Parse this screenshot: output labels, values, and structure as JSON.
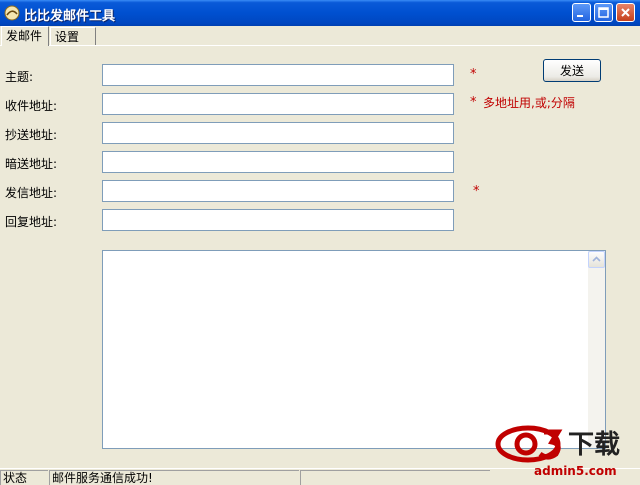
{
  "window": {
    "title": "比比发邮件工具"
  },
  "tabs": [
    {
      "label": "发邮件"
    },
    {
      "label": "设置"
    }
  ],
  "form": {
    "fields": [
      {
        "label": "主题:",
        "value": ""
      },
      {
        "label": "收件地址:",
        "value": ""
      },
      {
        "label": "抄送地址:",
        "value": ""
      },
      {
        "label": "暗送地址:",
        "value": ""
      },
      {
        "label": "发信地址:",
        "value": ""
      },
      {
        "label": "回复地址:",
        "value": ""
      }
    ],
    "required_mark": "*",
    "recipient_hint": "多地址用,或;分隔",
    "body_value": ""
  },
  "actions": {
    "send_label": "发送"
  },
  "statusbar": {
    "label": "状态",
    "message": "邮件服务通信成功!"
  },
  "watermark": {
    "logo_text": "下载",
    "url_text": "admin5.com"
  },
  "colors": {
    "titlebar": "#0050d0",
    "required": "#c00000",
    "face": "#ece9d8"
  }
}
